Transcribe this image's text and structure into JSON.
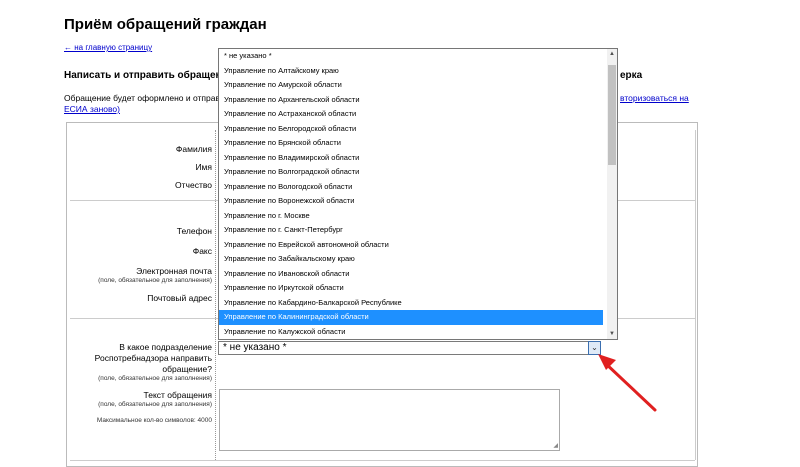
{
  "page": {
    "title": "Приём обращений граждан",
    "back_link": "← на главную страницу",
    "section_title": "Написать и отправить обращение",
    "section_title_right": "ерка",
    "description_line1": "Обращение будет оформлено и отправ",
    "description_line2": "ЕСИА заново)",
    "description_right_link": "вторизоваться на"
  },
  "form": {
    "fields": {
      "surname": "Фамилия",
      "name": "Имя",
      "patronymic": "Отчество",
      "phone": "Телефон",
      "fax": "Факс",
      "email": "Электронная почта",
      "email_note": "(поле, обязательное для заполнения)",
      "address": "Почтовый адрес",
      "department_q1": "В какое подразделение",
      "department_q2": "Роспотребнадзора направить",
      "department_q3": "обращение?",
      "department_note": "(поле, обязательное для заполнения)",
      "text": "Текст обращения",
      "text_note": "(поле, обязательное для заполнения)",
      "max_chars": "Максимальное кол-во символов: 4000"
    },
    "department_select": {
      "value": "* не указано *",
      "options": [
        "* не указано *",
        "Управление по Алтайскому краю",
        "Управление по Амурской области",
        "Управление по Архангельской области",
        "Управление по Астраханской области",
        "Управление по Белгородской области",
        "Управление по Брянской области",
        "Управление по Владимирской области",
        "Управление по Волгоградской области",
        "Управление по Вологодской области",
        "Управление по Воронежской области",
        "Управление по г. Москве",
        "Управление по г. Санкт-Петербург",
        "Управление по Еврейской автономной области",
        "Управление по Забайкальскому краю",
        "Управление по Ивановской области",
        "Управление по Иркутской области",
        "Управление по Кабардино-Балкарской Республике",
        "Управление по Калининградской области",
        "Управление по Калужской области"
      ],
      "highlighted_index": 18
    }
  },
  "colors": {
    "link": "#0000cc",
    "highlight": "#1e90ff",
    "annotation_arrow": "#e02020"
  }
}
